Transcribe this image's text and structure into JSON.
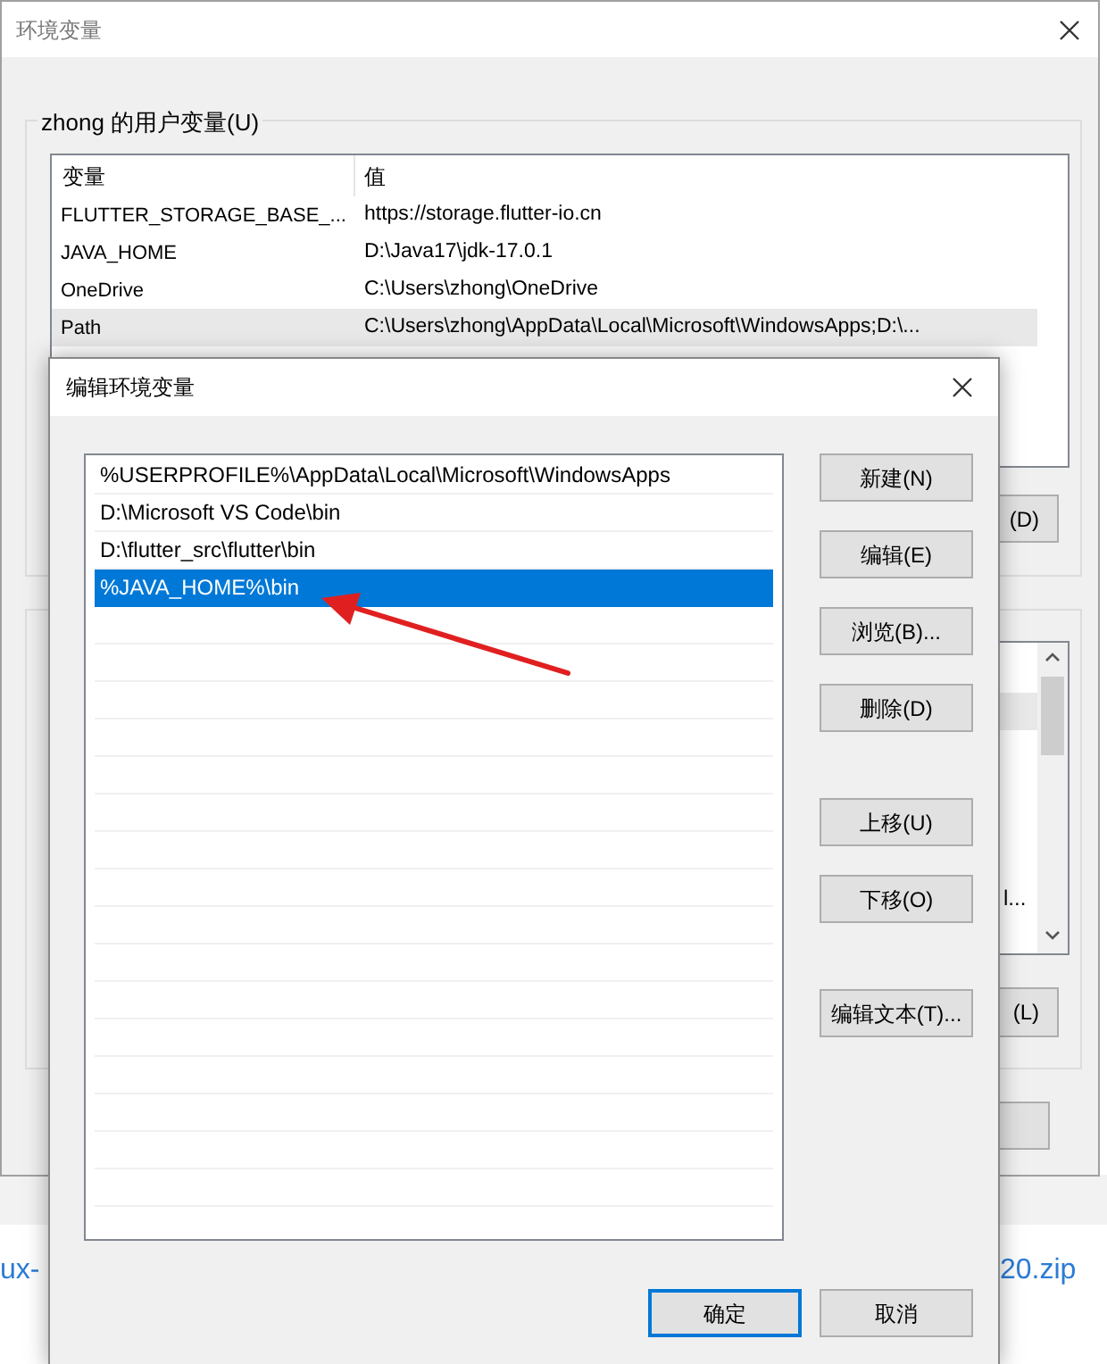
{
  "back_window": {
    "title": "环境变量",
    "user_group": {
      "title": "zhong 的用户变量(U)",
      "columns": [
        "变量",
        "值"
      ],
      "rows": [
        {
          "name": "FLUTTER_STORAGE_BASE_...",
          "value": "https://storage.flutter-io.cn",
          "selected": false
        },
        {
          "name": "JAVA_HOME",
          "value": "D:\\Java17\\jdk-17.0.1",
          "selected": false
        },
        {
          "name": "OneDrive",
          "value": "C:\\Users\\zhong\\OneDrive",
          "selected": false
        },
        {
          "name": "Path",
          "value": "C:\\Users\\zhong\\AppData\\Local\\Microsoft\\WindowsApps;D:\\...",
          "selected": true
        }
      ],
      "button": "(D)"
    },
    "system_group": {
      "list_fragment": "l...",
      "button": "(L)"
    }
  },
  "page_links": [
    "ux-",
    "20.zip"
  ],
  "dialog": {
    "title": "编辑环境变量",
    "items": [
      {
        "text": "%USERPROFILE%\\AppData\\Local\\Microsoft\\WindowsApps",
        "selected": false
      },
      {
        "text": "D:\\Microsoft VS Code\\bin",
        "selected": false
      },
      {
        "text": "D:\\flutter_src\\flutter\\bin",
        "selected": false
      },
      {
        "text": "%JAVA_HOME%\\bin",
        "selected": true
      }
    ],
    "button_groups": [
      [
        "新建(N)",
        "编辑(E)",
        "浏览(B)...",
        "删除(D)"
      ],
      [
        "上移(U)",
        "下移(O)"
      ],
      [
        "编辑文本(T)..."
      ]
    ],
    "ok": "确定",
    "cancel": "取消"
  }
}
